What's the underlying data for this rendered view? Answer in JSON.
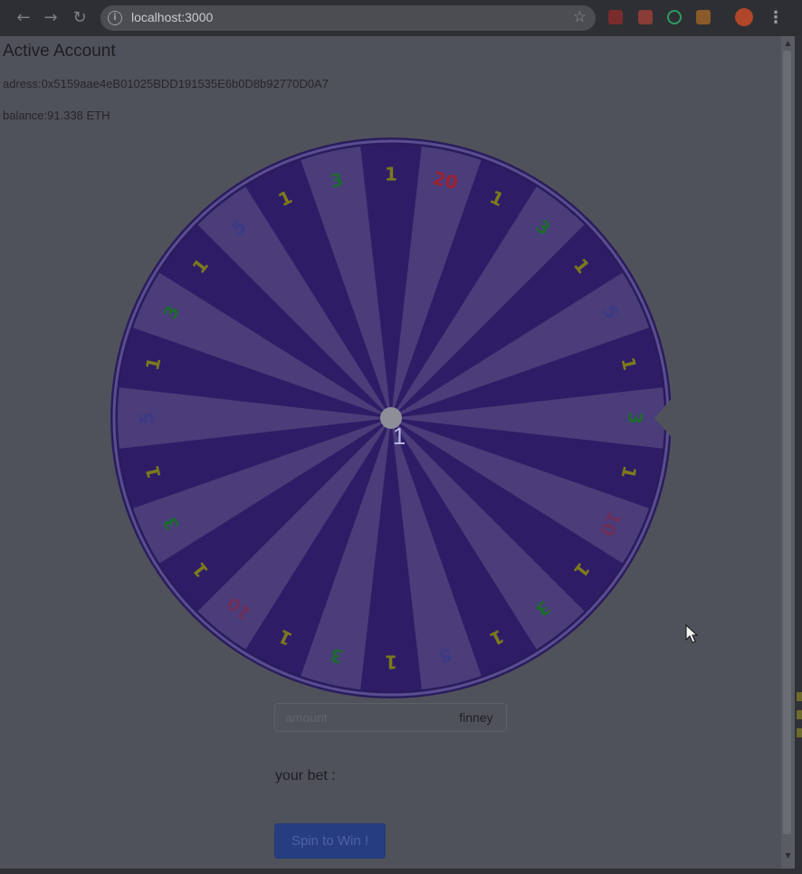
{
  "browser": {
    "url": "localhost:3000",
    "icons": {
      "back": "arrow-left-icon",
      "forward": "arrow-right-icon",
      "reload": "reload-icon",
      "info": "info-icon",
      "star": "star-icon",
      "menu": "kebab-menu-icon"
    },
    "extensions": [
      "ublock-icon",
      "extension-icon",
      "extension-icon",
      "metamask-fox-icon",
      "profile-avatar-icon"
    ]
  },
  "account": {
    "heading": "Active Account",
    "address_line": "adress:0x5159aae4eB01025BDD191535E6b0D8b92770D0A7",
    "balance_line": "balance:91.338 ETH"
  },
  "wheel": {
    "center_value": "1",
    "segments": [
      "1",
      "20",
      "1",
      "3",
      "1",
      "5",
      "1",
      "3",
      "1",
      "10",
      "1",
      "3",
      "1",
      "5",
      "1",
      "3",
      "1",
      "10",
      "1",
      "3",
      "1",
      "5",
      "1",
      "3",
      "1",
      "5",
      "1",
      "3"
    ],
    "value_colors": {
      "1": "#7c7a1c",
      "3": "#1f6a30",
      "5": "#3c3a85",
      "10": "#6c2e5a",
      "20": "#9a2232"
    },
    "colors": {
      "dark": "#2e1d66",
      "light": "#4a3d7a",
      "rim": "#4b3d86",
      "hub": "#8e8e98"
    }
  },
  "bet": {
    "amount_placeholder": "amount",
    "amount_value": "",
    "unit": "finney",
    "your_bet_label": "your bet :",
    "spin_label": "Spin to Win !"
  }
}
